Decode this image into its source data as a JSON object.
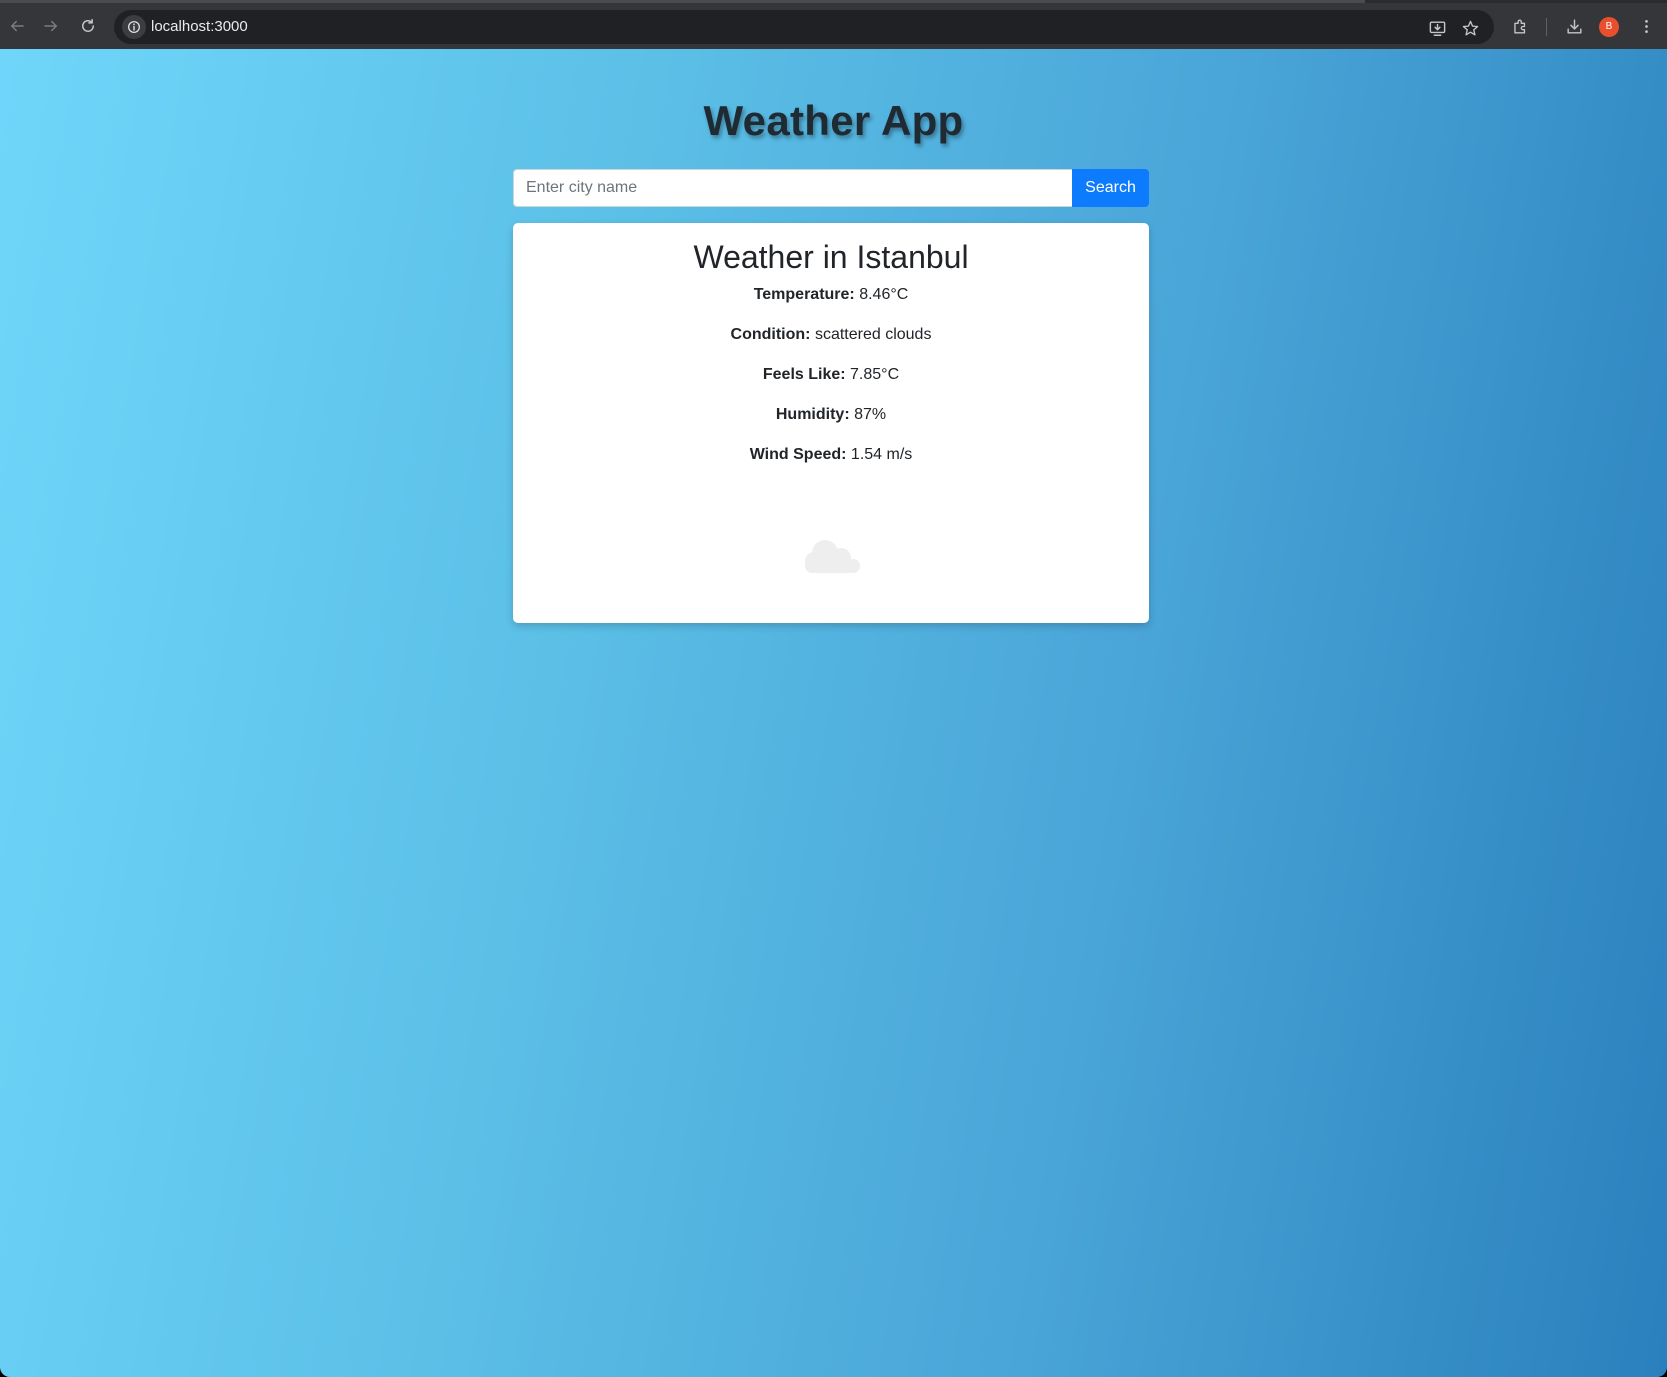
{
  "browser": {
    "url": "localhost:3000",
    "profile_initial": "B",
    "accent_colors": {
      "toolbar": "#35363a",
      "omnibox": "#202124",
      "avatar": "#ea4f2d"
    }
  },
  "page": {
    "app_title": "Weather App",
    "search": {
      "placeholder": "Enter city name",
      "value": "",
      "button_label": "Search"
    },
    "card": {
      "title": "Weather in Istanbul",
      "rows": [
        {
          "label": "Temperature:",
          "value": " 8.46°C"
        },
        {
          "label": "Condition:",
          "value": " scattered clouds"
        },
        {
          "label": "Feels Like:",
          "value": " 7.85°C"
        },
        {
          "label": "Humidity:",
          "value": " 87%"
        },
        {
          "label": "Wind Speed:",
          "value": " 1.54 m/s"
        }
      ],
      "weather_icon": "cloud-icon"
    },
    "colors": {
      "gradient_start": "#6fd6fa",
      "gradient_end": "#2a80bc",
      "button": "#0d7bfe"
    }
  }
}
